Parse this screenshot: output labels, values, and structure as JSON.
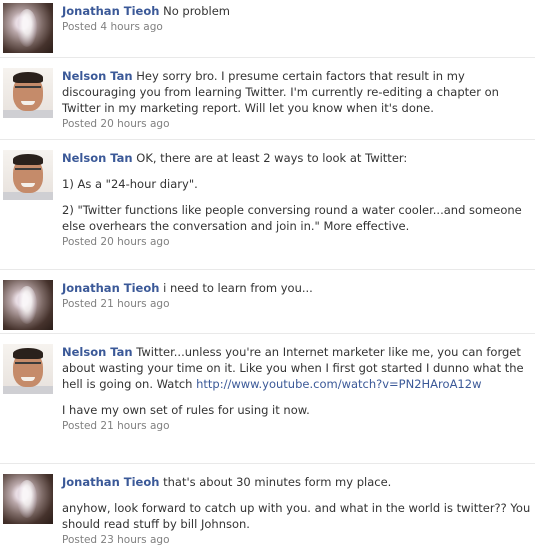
{
  "posts": [
    {
      "author": "Jonathan Tieoh",
      "text": "No problem",
      "timestamp": "Posted 4 hours ago"
    },
    {
      "author": "Nelson Tan",
      "text": "Hey sorry bro. I presume certain factors that result in my discouraging you from learning Twitter. I'm currently re-editing a chapter on Twitter in my marketing report. Will let you know when it's done.",
      "timestamp": "Posted 20 hours ago"
    },
    {
      "author": "Nelson Tan",
      "text": "OK, there are at least 2 ways to look at Twitter:",
      "para1": "1) As a \"24-hour diary\".",
      "para2": "2) \"Twitter functions like people conversing round a water cooler...and someone else overhears the conversation and join in.\" More effective.",
      "timestamp": "Posted 20 hours ago"
    },
    {
      "author": "Jonathan Tieoh",
      "text": "i need to learn from you...",
      "timestamp": "Posted 21 hours ago"
    },
    {
      "author": "Nelson Tan",
      "text": "Twitter...unless you're an Internet marketer like me, you can forget about wasting your time on it. Like you when I first got started I dunno what the hell is going on. Watch",
      "link": "http://www.youtube.com/watch?v=PN2HAroA12w",
      "para1": "I have my own set of rules for using it now.",
      "timestamp": "Posted 21 hours ago"
    },
    {
      "author": "Jonathan Tieoh",
      "text": "that's about 30 minutes form my place.",
      "para1": "anyhow, look forward to catch up with you. and what in the world is twitter?? You should read stuff by bill Johnson.",
      "timestamp": "Posted 23 hours ago"
    }
  ]
}
